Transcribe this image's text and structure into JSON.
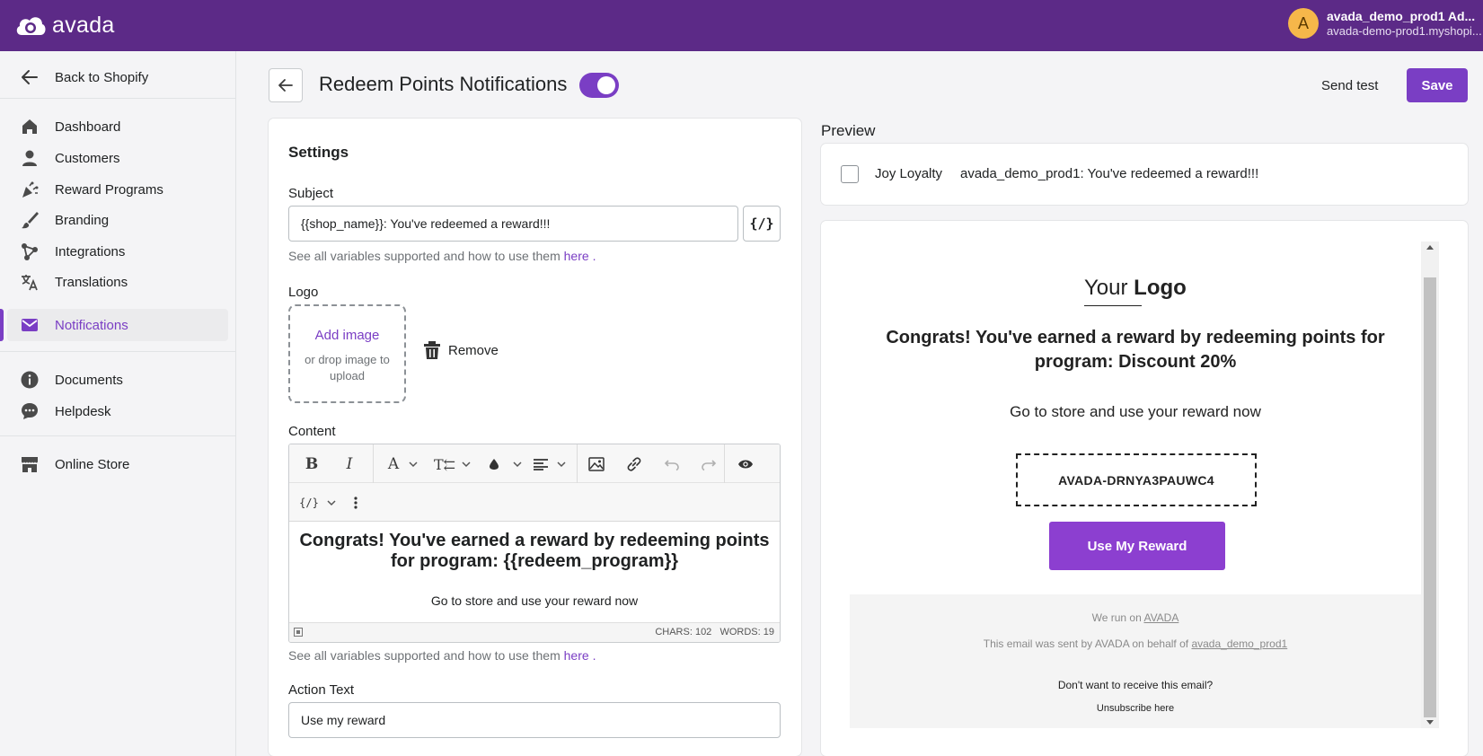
{
  "topbar": {
    "brand": "avada",
    "avatar_initial": "A",
    "account_name": "avada_demo_prod1 Ad...",
    "account_domain": "avada-demo-prod1.myshopi..."
  },
  "sidebar": {
    "back": "Back to Shopify",
    "items": [
      {
        "label": "Dashboard",
        "icon": "home-icon"
      },
      {
        "label": "Customers",
        "icon": "person-icon"
      },
      {
        "label": "Reward Programs",
        "icon": "confetti-icon"
      },
      {
        "label": "Branding",
        "icon": "brush-icon"
      },
      {
        "label": "Integrations",
        "icon": "network-icon"
      },
      {
        "label": "Translations",
        "icon": "translate-icon"
      },
      {
        "label": "Notifications",
        "icon": "mail-icon",
        "active": true
      }
    ],
    "secondary": [
      {
        "label": "Documents",
        "icon": "info-icon"
      },
      {
        "label": "Helpdesk",
        "icon": "chat-icon"
      }
    ],
    "store": {
      "label": "Online Store",
      "icon": "store-icon"
    }
  },
  "header": {
    "title": "Redeem Points Notifications",
    "enabled": true,
    "send_test": "Send test",
    "save": "Save"
  },
  "settings": {
    "title": "Settings",
    "subject_label": "Subject",
    "subject_value": "{{shop_name}}: You've redeemed a reward!!!",
    "variable_btn": "{/}",
    "help_text": "See all variables supported and how to use them",
    "help_link": "here",
    "help_end": ".",
    "logo_label": "Logo",
    "add_image": "Add image",
    "drop_text": "or drop image to upload",
    "remove": "Remove",
    "content_label": "Content",
    "editor_heading": "Congrats! You've earned a reward by redeeming points for program: {{redeem_program}}",
    "editor_text": "Go to store and use your reward now",
    "chars": "CHARS: 102",
    "words": "WORDS: 19",
    "action_label": "Action Text",
    "action_value": "Use my reward"
  },
  "preview": {
    "label": "Preview",
    "sender": "Joy Loyalty",
    "subject": "avada_demo_prod1: You've redeemed a reward!!!",
    "logo_your": "Your",
    "logo_logo": "Logo",
    "heading": "Congrats! You've earned a reward by redeeming points for program: Discount 20%",
    "text": "Go to store and use your reward now",
    "code": "AVADA-DRNYA3PAUWC4",
    "button": "Use My Reward",
    "we_run": "We run on",
    "we_run_link": "AVADA",
    "sent_by": "This email was sent by AVADA on behalf of",
    "sent_by_link": "avada_demo_prod1",
    "dont_want": "Don't want to receive this email?",
    "unsubscribe": "Unsubscribe here"
  },
  "colors": {
    "topbar": "#5c2a87",
    "accent": "#7a3ec4",
    "reward_button": "#8c3fd0"
  }
}
